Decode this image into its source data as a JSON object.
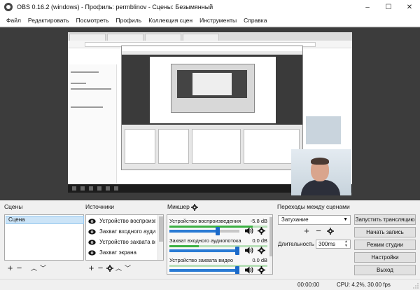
{
  "window": {
    "title": "OBS 0.16.2 (windows) - Профиль: permblinov - Сцены: Безымянный",
    "controls": {
      "minimize": "–",
      "maximize": "☐",
      "close": "✕"
    }
  },
  "menu": [
    "Файл",
    "Редактировать",
    "Посмотреть",
    "Профиль",
    "Коллекция сцен",
    "Инструменты",
    "Справка"
  ],
  "scenes": {
    "label": "Сцены",
    "items": [
      "Сцена"
    ],
    "tools": {
      "add": "+",
      "remove": "−",
      "up": "︿",
      "down": "﹀"
    }
  },
  "sources": {
    "label": "Источники",
    "items": [
      "Устройство воспроизв",
      "Захват входного ауди",
      "Устройство захвата вь",
      "Захват экрана"
    ],
    "tools": {
      "add": "+",
      "remove": "−",
      "up": "︿",
      "down": "﹀"
    }
  },
  "mixer": {
    "label": "Микшер",
    "channels": [
      {
        "name": "Устройство воспроизведения",
        "db": "-5.8 dB",
        "level": 0.85,
        "volume": 0.72
      },
      {
        "name": "Захват входного аудиопотока",
        "db": "0.0 dB",
        "level": 0.3,
        "volume": 1.0
      },
      {
        "name": "Устройство захвата видео",
        "db": "0.0 dB",
        "level": 0.0,
        "volume": 1.0
      }
    ]
  },
  "transitions": {
    "label": "Переходы между сценами",
    "selected": "Затухание",
    "duration_label": "Длительность",
    "duration_value": "300ms",
    "tools": {
      "add": "+",
      "remove": "−"
    }
  },
  "controls": {
    "start_streaming": "Запустить трансляцию",
    "start_recording": "Начать запись",
    "studio_mode": "Режим студии",
    "settings": "Настройки",
    "exit": "Выход"
  },
  "status": {
    "time": "00:00:00",
    "cpu": "CPU: 4.2%, 30.00 fps"
  },
  "colors": {
    "accent": "#2a7bd4",
    "meter": "#3cb043",
    "preview_bg": "#3c3c3c",
    "selection": "#cce4f7"
  }
}
